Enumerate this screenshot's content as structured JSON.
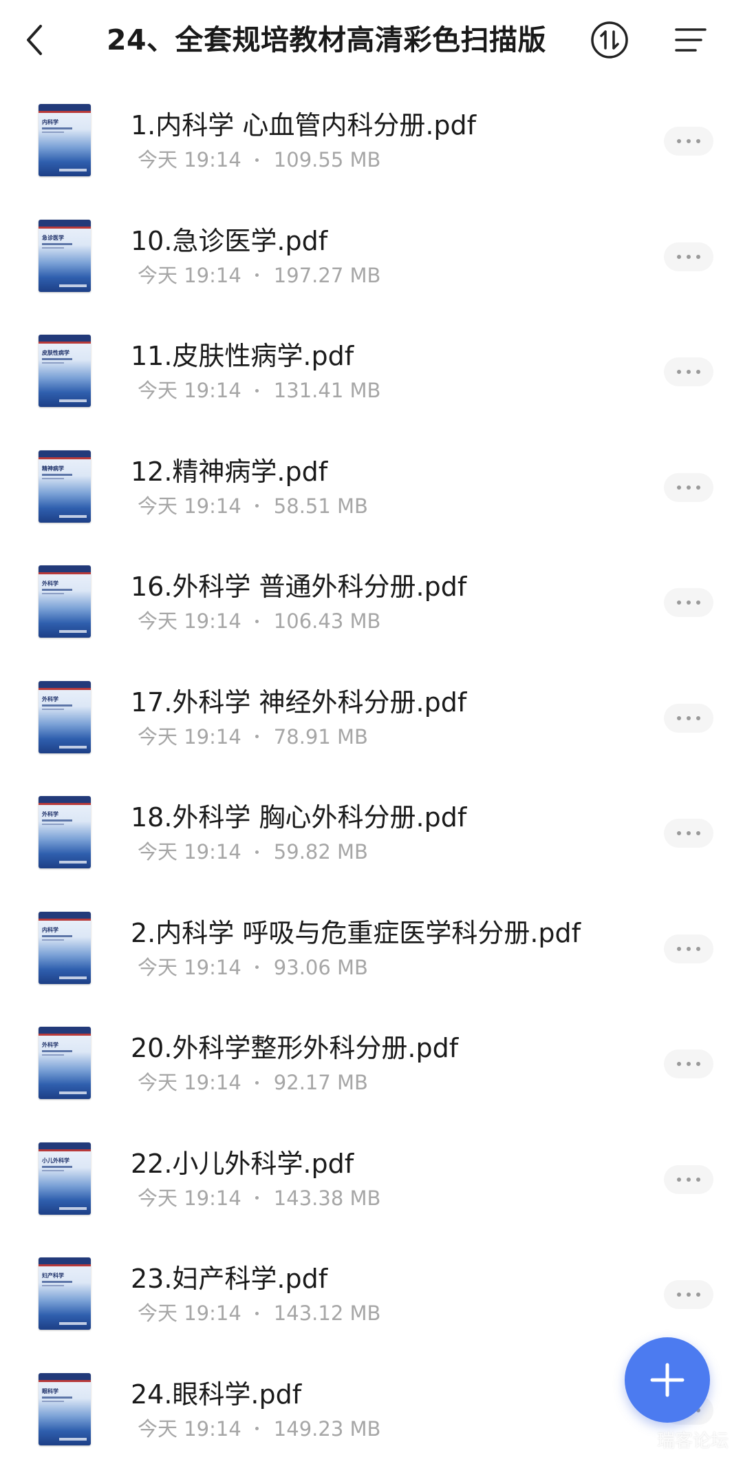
{
  "header": {
    "title": "24、全套规培教材高清彩色扫描版",
    "back_icon": "chevron-left-icon",
    "sort_icon": "sort-arrows-circle-icon",
    "menu_icon": "hamburger-menu-icon"
  },
  "files": [
    {
      "name": "1.内科学 心血管内科分册.pdf",
      "date": "今天 19:14",
      "size": "109.55 MB",
      "cover_title": "内科学"
    },
    {
      "name": "10.急诊医学.pdf",
      "date": "今天 19:14",
      "size": "197.27 MB",
      "cover_title": "急诊医学"
    },
    {
      "name": "11.皮肤性病学.pdf",
      "date": "今天 19:14",
      "size": "131.41 MB",
      "cover_title": "皮肤性病学"
    },
    {
      "name": "12.精神病学.pdf",
      "date": "今天 19:14",
      "size": "58.51 MB",
      "cover_title": "精神病学"
    },
    {
      "name": "16.外科学 普通外科分册.pdf",
      "date": "今天 19:14",
      "size": "106.43 MB",
      "cover_title": "外科学"
    },
    {
      "name": "17.外科学 神经外科分册.pdf",
      "date": "今天 19:14",
      "size": "78.91 MB",
      "cover_title": "外科学"
    },
    {
      "name": "18.外科学 胸心外科分册.pdf",
      "date": "今天 19:14",
      "size": "59.82 MB",
      "cover_title": "外科学"
    },
    {
      "name": "2.内科学 呼吸与危重症医学科分册.pdf",
      "date": "今天 19:14",
      "size": "93.06 MB",
      "cover_title": "内科学"
    },
    {
      "name": "20.外科学整形外科分册.pdf",
      "date": "今天 19:14",
      "size": "92.17 MB",
      "cover_title": "外科学"
    },
    {
      "name": "22.小儿外科学.pdf",
      "date": "今天 19:14",
      "size": "143.38 MB",
      "cover_title": "小儿外科学"
    },
    {
      "name": "23.妇产科学.pdf",
      "date": "今天 19:14",
      "size": "143.12 MB",
      "cover_title": "妇产科学"
    },
    {
      "name": "24.眼科学.pdf",
      "date": "今天 19:14",
      "size": "149.23 MB",
      "cover_title": "眼科学"
    }
  ],
  "fab": {
    "icon": "plus-icon",
    "color": "#4c7bf0"
  },
  "watermark": "瑞客论坛"
}
